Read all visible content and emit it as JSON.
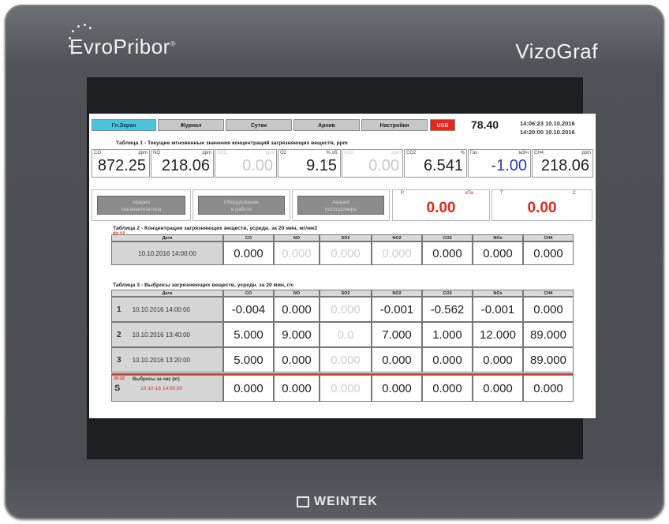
{
  "device": {
    "brand_left": "EvroPribor",
    "brand_mark": "®",
    "brand_right": "VizoGraf",
    "maker": "WEINTEK"
  },
  "nav": {
    "items": [
      "Гл.Экран",
      "Журнал",
      "Сутки",
      "Архив",
      "Настройки"
    ],
    "usb": "USB",
    "value": "78.40",
    "time1": "14:06:23 10.10.2016",
    "time2": "14:20:00 10.10.2016"
  },
  "table1": {
    "title": "Таблица 1 - Текущие мгновенные значения концентраций загрязняющих веществ, ppm",
    "cells": [
      {
        "label": "CO",
        "unit": "ppm",
        "value": "872.25"
      },
      {
        "label": "NO",
        "unit": "ppm",
        "value": "218.06"
      },
      {
        "label": "SO2",
        "unit": "ppm",
        "value": "0.00"
      },
      {
        "label": "O2",
        "unit": "% об.",
        "value": "9.15"
      },
      {
        "label": "NO2",
        "unit": "ppm",
        "value": "0.00"
      },
      {
        "label": "CO2",
        "unit": "%",
        "value": "6.541"
      },
      {
        "label": "Газ",
        "unit": "м3/ч",
        "value": "-1.00"
      },
      {
        "label": "CH4",
        "unit": "ppm",
        "value": "218.06"
      }
    ]
  },
  "alarms": {
    "buttons": [
      {
        "line1": "Авария",
        "line2": "газоанализатора"
      },
      {
        "line1": "Оборудование",
        "line2": "в работе"
      },
      {
        "line1": "Авария",
        "line2": "расходомера"
      }
    ],
    "p": {
      "label": "P",
      "unit": "кПа",
      "value": "0.00"
    },
    "t": {
      "label": "T",
      "unit": "C",
      "value": "0.00"
    }
  },
  "table2": {
    "title": "Таблица 2 - Концентрации загрязняющих веществ, усредн. за 20 мин, мг/нм3",
    "stamp": "00:27",
    "headers": [
      "Дата",
      "CO",
      "NO",
      "SO2",
      "NO2",
      "CO2",
      "NOx",
      "CH4"
    ],
    "row": {
      "date": "10.10.2016 14:00:00",
      "values": [
        "0.000",
        "0.000",
        "0.000",
        "0.000",
        "0.000",
        "0.000",
        "0.000"
      ]
    }
  },
  "table3": {
    "title": "Таблица 3 - Выбросы загрязняющих веществ, усредн. за 20 мин, г/с",
    "headers": [
      "Дата",
      "CO",
      "NO",
      "SO2",
      "NO2",
      "CO2",
      "NOx",
      "CH4"
    ],
    "rows": [
      {
        "idx": "1",
        "date": "10.10.2016 14:00:00",
        "values": [
          "-0.004",
          "0.000",
          "0.000",
          "-0.001",
          "-0.562",
          "-0.001",
          "0.000"
        ]
      },
      {
        "idx": "2",
        "date": "10.10.2016 13:40:00",
        "values": [
          "5.000",
          "9.000",
          "0.0",
          "7.000",
          "1.000",
          "12.000",
          "89.000"
        ]
      },
      {
        "idx": "3",
        "date": "10.10.2016 13:20:00",
        "values": [
          "5.000",
          "0.000",
          "0.000",
          "0.000",
          "0.000",
          "0.000",
          "89.000"
        ]
      }
    ],
    "sum": {
      "stamp": "20:22",
      "idx": "S",
      "label": "Выбросы за час (кг)",
      "date": "10-10-16 14:00:00",
      "values": [
        "0.000",
        "0.000",
        "0.000",
        "0.000",
        "0.000",
        "0.000",
        "0.000"
      ]
    }
  },
  "colors": {
    "accent": "#4cc3dc",
    "alarm": "#e02b1c",
    "bezel": "#4f5257"
  }
}
